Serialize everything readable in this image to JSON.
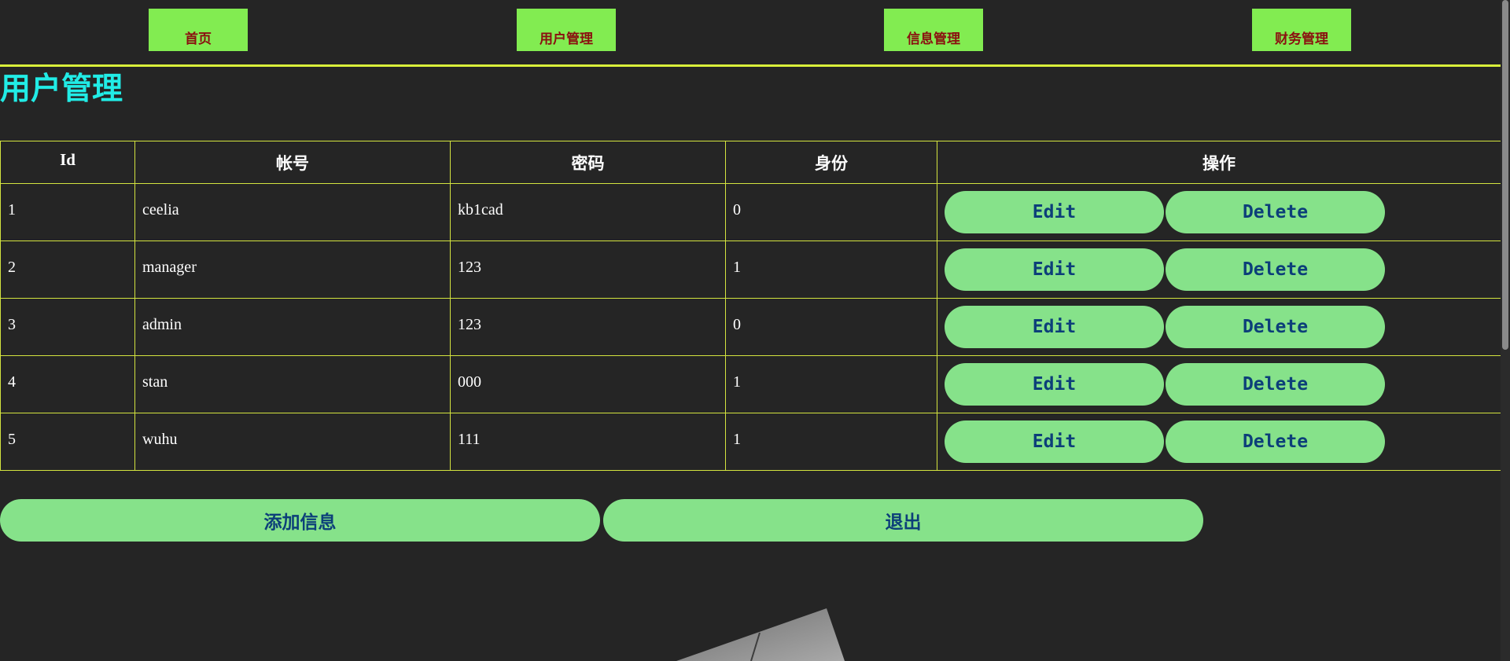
{
  "nav": {
    "items": [
      {
        "label": "首页"
      },
      {
        "label": "用户管理"
      },
      {
        "label": "信息管理"
      },
      {
        "label": "财务管理"
      }
    ]
  },
  "page": {
    "title": "用户管理"
  },
  "table": {
    "headers": {
      "id": "Id",
      "account": "帐号",
      "password": "密码",
      "role": "身份",
      "actions": "操作"
    },
    "rows": [
      {
        "id": "1",
        "account": "ceelia",
        "password": "kb1cad",
        "role": "0"
      },
      {
        "id": "2",
        "account": "manager",
        "password": "123",
        "role": "1"
      },
      {
        "id": "3",
        "account": "admin",
        "password": "123",
        "role": "0"
      },
      {
        "id": "4",
        "account": "stan",
        "password": "000",
        "role": "1"
      },
      {
        "id": "5",
        "account": "wuhu",
        "password": "111",
        "role": "1"
      }
    ],
    "edit_label": "Edit",
    "delete_label": "Delete"
  },
  "actions": {
    "add_label": "添加信息",
    "logout_label": "退出"
  },
  "colors": {
    "background": "#252525",
    "nav_button": "#82ec51",
    "nav_text": "#8a1010",
    "title": "#21ece6",
    "border": "#d4e43f",
    "button": "#86e28a",
    "button_text": "#0c3f79"
  }
}
